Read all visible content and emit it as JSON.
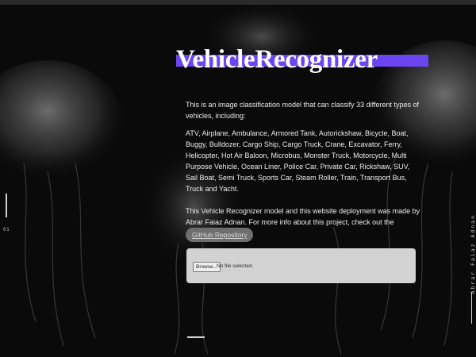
{
  "app": {
    "title": "VehicleRecognizer",
    "accent_color": "#6a45f0"
  },
  "side": {
    "page_number": "01",
    "author_vertical": "Abrar Faiaz Adnan"
  },
  "description": {
    "intro": "This is an image classification model that can classify 33 different types of vehicles, including:",
    "vehicle_list": "ATV, Airplane, Ambulance, Armored Tank, Autorickshaw, Bicycle, Boat, Buggy, Bulldozer, Cargo Ship, Cargo Truck, Crane, Excavator, Ferry, Helicopter, Hot Air Baloon, Microbus, Monster Truck, Motorcycle, Multi Purpose Vehicle, Ocean Liner, Police Car, Private Car, Rickshaw, SUV, Sail Boat, Semi Truck, Sports Car, Steam Roller, Train, Transport Bus, Truck and Yacht.",
    "credit": "This Vehicle Recognizer model and this website deployment was made by Abrar Faiaz Adnan. For more info about this project, check out the",
    "repo_link_label": "GitHub Repository"
  },
  "upload": {
    "browse_label": "Browse...",
    "status": "No file selected."
  },
  "icons": {
    "background": "jellyfish-background"
  }
}
